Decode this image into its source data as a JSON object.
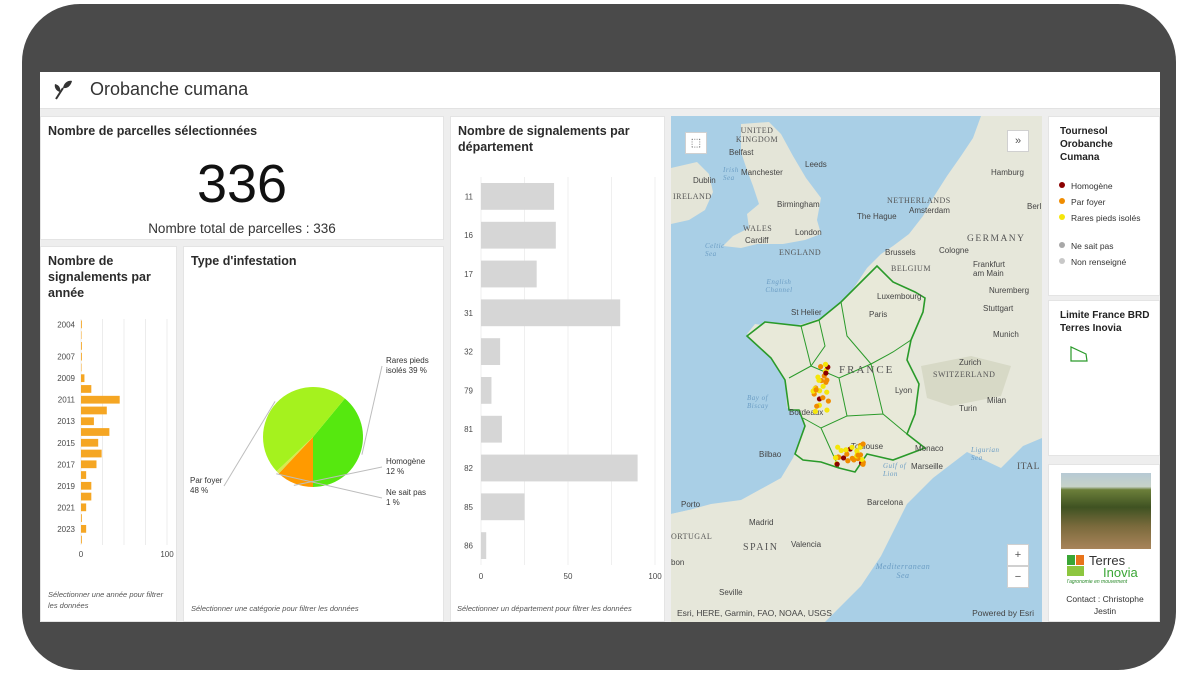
{
  "app": {
    "title": "Orobanche cumana"
  },
  "kpi": {
    "title": "Nombre de parcelles sélectionnées",
    "value": "336",
    "subtitle": "Nombre total de parcelles : 336"
  },
  "year_chart": {
    "title": "Nombre de signalements par année",
    "note": "Sélectionner une année pour filtrer les données"
  },
  "pie_chart": {
    "title": "Type d'infestation",
    "note": "Sélectionner une catégorie pour filtrer les données"
  },
  "dept_chart": {
    "title": "Nombre de signalements par département",
    "note": "Sélectionner un département pour filtrer les données"
  },
  "legend": {
    "title": "Tournesol Orobanche Cumana",
    "items": [
      {
        "label": "Homogène",
        "color": "#8b0000"
      },
      {
        "label": "Par foyer",
        "color": "#f08c00"
      },
      {
        "label": "Rares pieds isolés",
        "color": "#f5e60a"
      },
      {
        "label": "Ne sait pas",
        "color": "#a8a8a8"
      },
      {
        "label": "Non renseigné",
        "color": "#c8c8c8"
      }
    ],
    "boundary_title": "Limite France BRD Terres Inovia"
  },
  "brand": {
    "name_line1": "Terres",
    "name_line2": "Inovia",
    "tagline": "l'agronomie en mouvement",
    "contact": "Contact : Christophe Jestin"
  },
  "map": {
    "attribution": "Esri, HERE, Garmin, FAO, NOAA, USGS",
    "powered_by": "Powered by Esri",
    "zoom_in": "+",
    "zoom_out": "−",
    "labels": {
      "uk": "UNITED KINGDOM",
      "belfast": "Belfast",
      "manchester": "Manchester",
      "leeds": "Leeds",
      "dublin": "Dublin",
      "ireland": "IRELAND",
      "birmingham": "Birmingham",
      "london": "London",
      "wales": "WALES",
      "cardiff": "Cardiff",
      "england": "ENGLAND",
      "netherlands": "NETHERLANDS",
      "amsterdam": "Amsterdam",
      "hague": "The Hague",
      "hamburg": "Hamburg",
      "berlin": "Berl",
      "germany": "GERMANY",
      "brussels": "Brussels",
      "belgium": "BELGIUM",
      "cologne": "Cologne",
      "frankfurt": "Frankfurt am Main",
      "nuremberg": "Nuremberg",
      "luxembourg": "Luxembourg",
      "stuttgart": "Stuttgart",
      "munich": "Munich",
      "paris": "Paris",
      "sthelier": "St Helier",
      "france": "FRANCE",
      "zurich": "Zurich",
      "switzerland": "SWITZERLAND",
      "celtic": "Celtic Sea",
      "channel": "English Channel",
      "irish": "Irish Sea",
      "biscay": "Bay of Biscay",
      "bordeaux": "Bordeaux",
      "lyon": "Lyon",
      "turin": "Turin",
      "milan": "Milan",
      "toulouse": "Toulouse",
      "monaco": "Monaco",
      "ligurian": "Ligurian Sea",
      "marseille": "Marseille",
      "bilbao": "Bilbao",
      "lion": "Gulf of Lion",
      "italy": "ITAL",
      "barcelona": "Barcelona",
      "porto": "Porto",
      "madrid": "Madrid",
      "portugal": "ORTUGAL",
      "spain": "SPAIN",
      "valencia": "Valencia",
      "lisbon": "bon",
      "mediterranean": "Mediterranean Sea",
      "seville": "Seville"
    }
  },
  "chart_data": [
    {
      "type": "bar",
      "orientation": "horizontal",
      "title": "Nombre de signalements par année",
      "categories": [
        "2004",
        "2005",
        "2006",
        "2007",
        "2008",
        "2009",
        "2010",
        "2011",
        "2012",
        "2013",
        "2014",
        "2015",
        "2016",
        "2017",
        "2018",
        "2019",
        "2020",
        "2021",
        "2022",
        "2023",
        "2024"
      ],
      "category_tick_labels": [
        "2004",
        "2007",
        "2009",
        "2011",
        "2013",
        "2015",
        "2017",
        "2019",
        "2021",
        "2023"
      ],
      "values": [
        1,
        0,
        1,
        1,
        0,
        4,
        12,
        45,
        30,
        15,
        33,
        20,
        24,
        18,
        6,
        12,
        12,
        6,
        1,
        6,
        1
      ],
      "xlim": [
        0,
        100
      ],
      "xticks": [
        0,
        100
      ],
      "color": "#f5a623"
    },
    {
      "type": "pie",
      "title": "Type d'infestation",
      "slices": [
        {
          "label": "Rares pieds isolés",
          "pct_label": "39 %",
          "value": 39,
          "color": "#56e80f"
        },
        {
          "label": "Homogène",
          "pct_label": "12 %",
          "value": 12,
          "color": "#ff9a00"
        },
        {
          "label": "Ne sait pas",
          "pct_label": "1 %",
          "value": 1,
          "color": "#d9e84d"
        },
        {
          "label": "Par foyer",
          "pct_label": "48 %",
          "value": 48,
          "color": "#a5f21e"
        }
      ]
    },
    {
      "type": "bar",
      "orientation": "horizontal",
      "title": "Nombre de signalements par département",
      "categories": [
        "11",
        "16",
        "17",
        "31",
        "32",
        "79",
        "81",
        "82",
        "85",
        "86"
      ],
      "values": [
        42,
        43,
        32,
        80,
        11,
        6,
        12,
        90,
        25,
        3
      ],
      "xlim": [
        0,
        100
      ],
      "xticks": [
        0,
        50,
        100
      ],
      "color": "#d6d6d6"
    }
  ]
}
